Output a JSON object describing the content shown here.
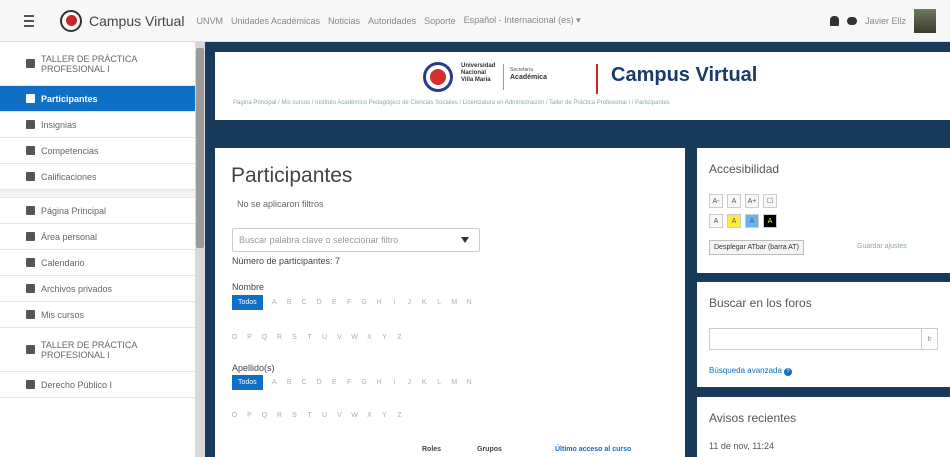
{
  "navbar": {
    "brand_name": "Campus Virtual",
    "links": [
      "UNVM",
      "Unidades Académicas",
      "Noticias",
      "Autoridades",
      "Soporte",
      "Español - Internacional (es) ▾"
    ],
    "user_name": "Javier Eliz"
  },
  "drawer": {
    "items": [
      {
        "label": "TALLER DE PRÁCTICA PROFESIONAL I",
        "icon": "graduation-cap-icon",
        "tall": true
      },
      {
        "label": "Participantes",
        "icon": "users-icon",
        "active": true
      },
      {
        "label": "Insignias",
        "icon": "badge-icon"
      },
      {
        "label": "Competencias",
        "icon": "check-icon"
      },
      {
        "label": "Calificaciones",
        "icon": "table-icon"
      },
      {
        "label": "Página Principal",
        "icon": "home-icon",
        "gap_before": true
      },
      {
        "label": "Área personal",
        "icon": "dashboard-icon"
      },
      {
        "label": "Calendario",
        "icon": "calendar-icon"
      },
      {
        "label": "Archivos privados",
        "icon": "file-icon"
      },
      {
        "label": "Mis cursos",
        "icon": "graduation-cap-icon"
      },
      {
        "label": "TALLER DE PRÁCTICA PROFESIONAL I",
        "icon": "graduation-cap-icon",
        "tall": true
      },
      {
        "label": "Derecho Público I",
        "icon": "graduation-cap-icon"
      }
    ]
  },
  "header": {
    "univ_line1": "Universidad",
    "univ_line2": "Nacional",
    "univ_line3": "Villa María",
    "sec_line1": "Secretaría",
    "sec_line2": "Académica",
    "title": "Campus Virtual",
    "breadcrumb": "Página Principal / Mis cursos / Instituto Académico Pedagógico de Ciencias Sociales / Licenciatura en Administración / Taller de Práctica Profesional I / Participantes"
  },
  "main": {
    "title": "Participantes",
    "no_filters": "No se aplicaron filtros",
    "filter_placeholder": "Buscar palabra clave o seleccionar filtro",
    "count": "Número de participantes: 7",
    "name_label": "Nombre",
    "surname_label": "Apellido(s)",
    "todos": "Todos",
    "letters_row1": [
      "A",
      "B",
      "C",
      "D",
      "E",
      "F",
      "G",
      "H",
      "I",
      "J",
      "K",
      "L",
      "M",
      "N"
    ],
    "letters_row2": [
      "O",
      "P",
      "Q",
      "R",
      "S",
      "T",
      "U",
      "V",
      "W",
      "X",
      "Y",
      "Z"
    ],
    "col_roles": "Roles",
    "col_groups": "Grupos",
    "col_last_access": "Último acceso al curso"
  },
  "accessibility": {
    "title": "Accesibilidad",
    "row1": [
      "A-",
      "A",
      "A+",
      "☐"
    ],
    "row2": [
      "A",
      "A",
      "A",
      "A"
    ],
    "atbar_button": "Desplegar ATbar (barra AT)",
    "atbar_link": "Guardar ajustes"
  },
  "forum_search": {
    "title": "Buscar en los foros",
    "go": "Ir",
    "advanced": "Búsqueda avanzada"
  },
  "news": {
    "title": "Avisos recientes",
    "date": "11 de nov, 11:24"
  }
}
